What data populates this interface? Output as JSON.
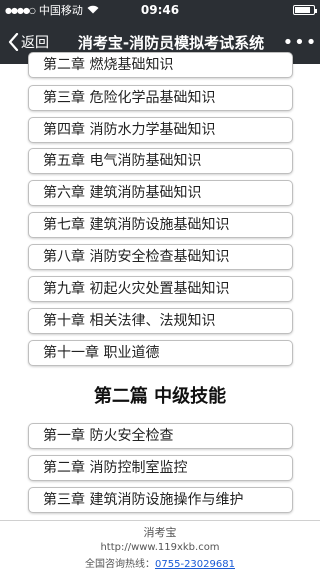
{
  "status_bar": {
    "carrier": "中国移动",
    "time": "09:46",
    "battery_level": 0.85
  },
  "nav": {
    "back_label": "返回",
    "title": "消考宝-消防员模拟考试系统",
    "more": "•••"
  },
  "chapters_part1": [
    "第二章 燃烧基础知识",
    "第三章 危险化学品基础知识",
    "第四章 消防水力学基础知识",
    "第五章 电气消防基础知识",
    "第六章 建筑消防基础知识",
    "第七章 建筑消防设施基础知识",
    "第八章 消防安全检查基础知识",
    "第九章 初起火灾处置基础知识",
    "第十章 相关法律、法规知识",
    "第十一章 职业道德"
  ],
  "section2": {
    "title": "第二篇 中级技能",
    "chapters": [
      "第一章 防火安全检查",
      "第二章 消防控制室监控",
      "第三章 建筑消防设施操作与维护"
    ]
  },
  "footer": {
    "name": "消考宝",
    "url": "http://www.119xkb.com",
    "hotline_label": "全国咨询热线：",
    "hotline": "0755-23029681"
  }
}
